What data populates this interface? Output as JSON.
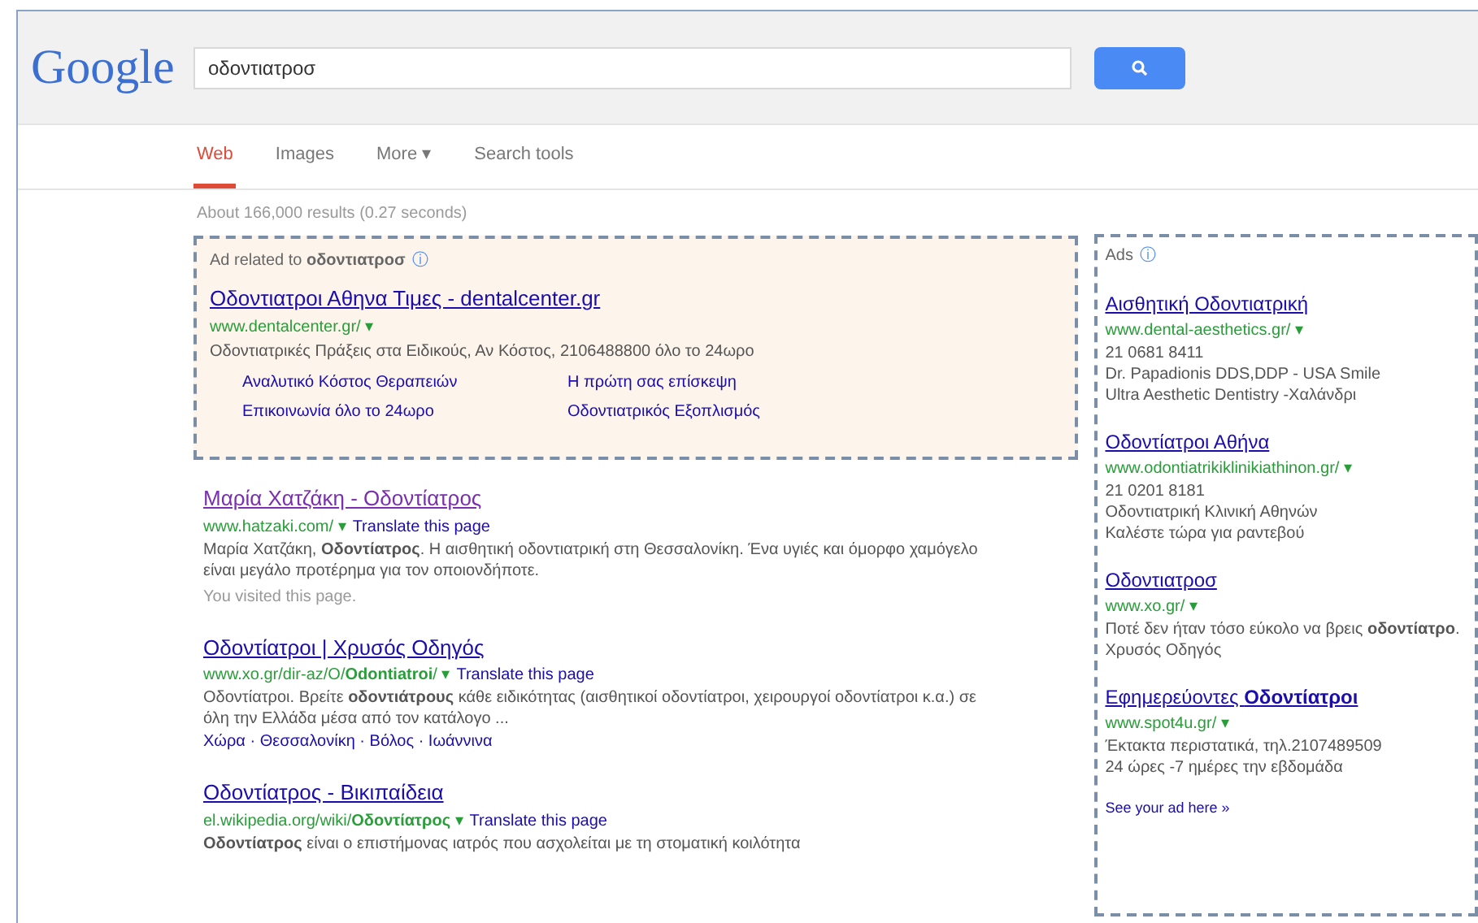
{
  "header": {
    "logo": "Google",
    "query": "οδοντιατροσ"
  },
  "tabs": [
    {
      "label": "Web",
      "selected": true
    },
    {
      "label": "Images",
      "selected": false
    },
    {
      "label": "More ▾",
      "selected": false
    },
    {
      "label": "Search tools",
      "selected": false
    }
  ],
  "result_stats": "About 166,000 results (0.27 seconds)",
  "top_ad": {
    "label": "Ad related to **οδοντιατροσ**",
    "info": "ⓘ",
    "title": "Οδοντιατροι Αθηνα Τιμες - dentalcenter.gr",
    "url": "www.dentalcenter.gr/ ▾",
    "snippet": "Οδοντιατρικές Πράξεις στα Ειδικούς, Αν Κόστος, 2106488800 όλο το 24ωρο",
    "sitelinks": [
      "Αναλυτικό Κόστος Θεραπειών",
      "Η πρώτη σας επίσκεψη",
      "Επικοινωνία όλο το 24ωρο",
      "Οδοντιατρικός Εξοπλισμός"
    ]
  },
  "results": [
    {
      "title": "Μαρία Χατζάκη - Οδοντίατρος",
      "visited": true,
      "url": "www.hatzaki.com/ ▾",
      "translate": "Translate this page",
      "snippet": "Μαρία Χατζάκη, **Οδοντίατρος**. Η αισθητική οδοντιατρική στη Θεσσαλονίκη. Ένα υγιές και όμορφο χαμόγελο είναι μεγάλο προτέρημα για τον οποιονδήποτε.",
      "note": "You visited this page."
    },
    {
      "title": "Οδοντίατροι | Χρυσός Οδηγός",
      "visited": false,
      "url": "www.xo.gr/dir-az/O/**Odontiatroi**/ ▾",
      "translate": "Translate this page",
      "snippet": "Οδοντίατροι. Βρείτε **οδοντιάτρους** κάθε ειδικότητας (αισθητικοί οδοντίατροι, χειρουργοί οδοντίατροι κ.α.) σε όλη την Ελλάδα μέσα από τον κατάλογο ...",
      "links": "Χώρα · Θεσσαλονίκη · Βόλος · Ιωάννινα"
    },
    {
      "title": "Οδοντίατρος - Βικιπαίδεια",
      "visited": false,
      "url": "el.wikipedia.org/wiki/**Οδοντίατρος** ▾",
      "translate": "Translate this page",
      "snippet": "**Οδοντίατρος** είναι ο επιστήμονας ιατρός που ασχολείται με τη στοματική κοιλότητα"
    }
  ],
  "side_ads": {
    "label": "Ads",
    "info": "ⓘ",
    "ads": [
      {
        "title": "Αισθητική Οδοντιατρική",
        "url": "www.dental-aesthetics.gr/ ▾",
        "lines": [
          "21 0681 8411",
          "Dr. Papadionis DDS,DDP - USA Smile",
          "Ultra Aesthetic Dentistry -Χαλάνδρι"
        ]
      },
      {
        "title": "Οδοντίατροι Αθήνα",
        "url": "www.odontiatrikiklinikiathinon.gr/ ▾",
        "lines": [
          "21 0201 8181",
          "Οδοντιατρική Κλινική Αθηνών",
          "Καλέστε τώρα για ραντεβού"
        ]
      },
      {
        "title": "Οδοντιατροσ",
        "url": "www.xo.gr/ ▾",
        "lines": [
          "Ποτέ δεν ήταν τόσο εύκολο να βρεις **οδοντίατρο**. Χρυσός Οδηγός"
        ]
      },
      {
        "title": "Εφημερεύοντες **Οδοντίατροι**",
        "url": "www.spot4u.gr/ ▾",
        "lines": [
          "Έκτακτα περιστατικά, τηλ.2107489509",
          "24 ώρες -7 ημέρες την εβδομάδα"
        ]
      }
    ],
    "more": "See your ad here »"
  }
}
